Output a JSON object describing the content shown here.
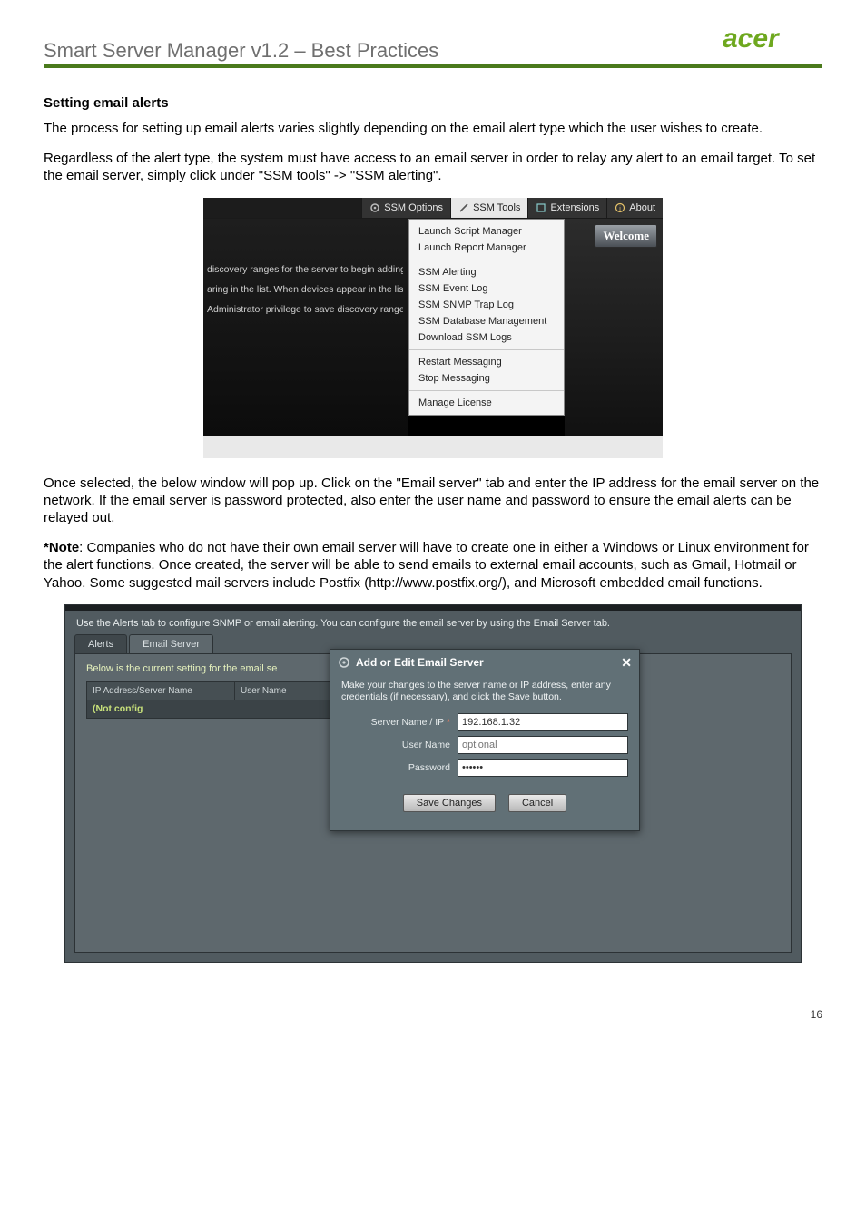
{
  "header": {
    "doc_title": "Smart Server Manager v1.2 – Best Practices"
  },
  "section": {
    "heading": "Setting email alerts",
    "p1": "The process for setting up email alerts varies slightly depending on the email alert type which the user wishes to create.",
    "p2": "Regardless of the alert type, the system must have access to an email server in order to relay any alert to an email target. To set the email server, simply click under \"SSM tools\" -> \"SSM alerting\".",
    "p3": "Once selected, the below window will pop up. Click on the \"Email server\" tab and enter the IP address for the email server on the network. If the email server is password protected, also enter the user name and password to ensure the email alerts can be relayed out.",
    "note_label": "*Note",
    "p4": ": Companies who do not have their own email server will have to create one in either a Windows or Linux environment for the alert functions. Once created, the server will be able to send emails to external email accounts, such as Gmail, Hotmail or Yahoo. Some suggested mail servers include Postfix (http://www.postfix.org/), and Microsoft embedded email functions."
  },
  "ss1": {
    "menubar": {
      "options": "SSM Options",
      "tools": "SSM Tools",
      "extensions": "Extensions",
      "about": "About"
    },
    "welcome": "Welcome",
    "left_lines": [
      "discovery ranges for the server to begin adding them",
      "aring in the list. When devices appear in the list, simply",
      "Administrator privilege to save discovery range setting"
    ],
    "dropdown": {
      "g1": [
        "Launch Script Manager",
        "Launch Report Manager"
      ],
      "g2": [
        "SSM Alerting",
        "SSM Event Log",
        "SSM SNMP Trap Log",
        "SSM Database Management",
        "Download SSM Logs"
      ],
      "g3": [
        "Restart Messaging",
        "Stop Messaging"
      ],
      "g4": [
        "Manage License"
      ]
    }
  },
  "ss2": {
    "desc": "Use the Alerts tab to configure SNMP or email alerting.  You can configure the email server by using the Email Server tab.",
    "tabs": {
      "alerts": "Alerts",
      "email": "Email Server"
    },
    "subtext": "Below is the current setting for the email se",
    "table": {
      "h1": "IP Address/Server Name",
      "h2": "User Name",
      "cell1": "(Not config"
    },
    "modal": {
      "title": "Add or Edit Email Server",
      "instr": "Make your changes to the server name or IP address, enter any credentials (if necessary), and click the Save button.",
      "labels": {
        "server": "Server Name / IP",
        "user": "User Name",
        "pass": "Password"
      },
      "values": {
        "server": "192.168.1.32",
        "user_placeholder": "optional",
        "pass": "••••••"
      },
      "buttons": {
        "save": "Save Changes",
        "cancel": "Cancel"
      }
    }
  },
  "page_number": "16"
}
